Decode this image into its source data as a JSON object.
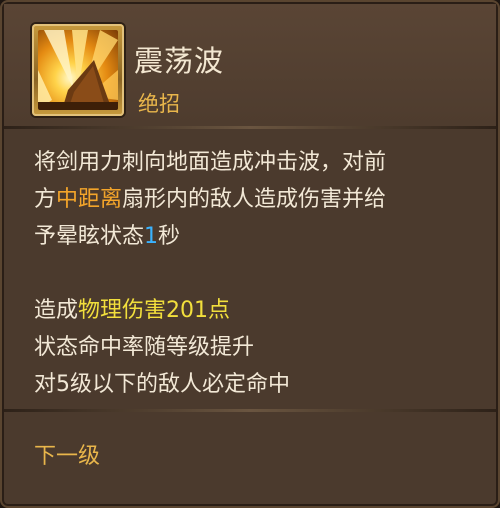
{
  "skill": {
    "name": "震荡波",
    "type": "绝招",
    "icon": "shockwave-skill-icon"
  },
  "description": {
    "line1": "将剑用力刺向地面造成冲击波，对前",
    "line2_pre": "方",
    "line2_range": "中距离",
    "line2_post": "扇形内的敌人造成伤害并给",
    "line3_pre": "予晕眩状态",
    "line3_seconds": "1",
    "line3_post": "秒"
  },
  "stats": {
    "damage_pre": "造成",
    "damage_value": "物理伤害201点",
    "line2": "状态命中率随等级提升",
    "line3": "对5级以下的敌人必定命中"
  },
  "next_level_label": "下一级",
  "colors": {
    "panel_bg": "#4b3a2d",
    "highlight_orange": "#f4a52a",
    "highlight_blue": "#3ab3ff",
    "highlight_yellow": "#f2df3c",
    "gold": "#e9b64b"
  }
}
